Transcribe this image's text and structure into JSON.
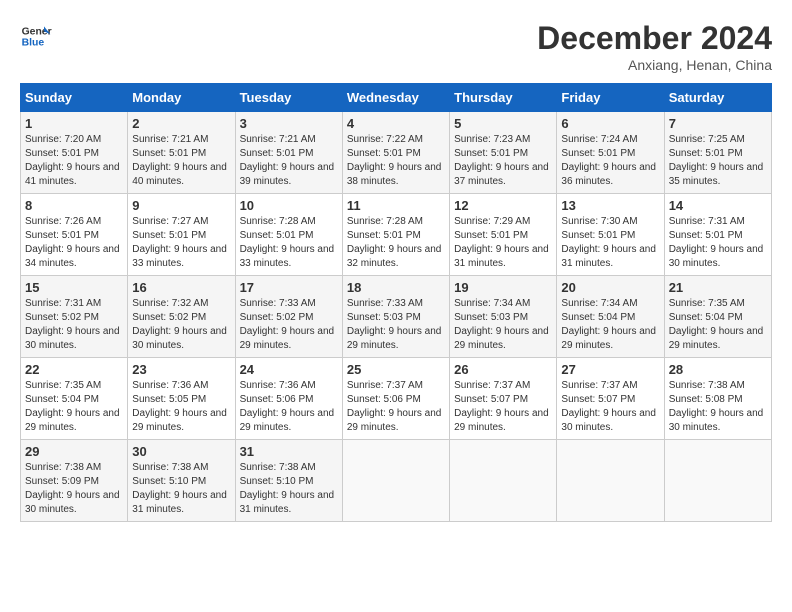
{
  "header": {
    "logo_line1": "General",
    "logo_line2": "Blue",
    "month": "December 2024",
    "location": "Anxiang, Henan, China"
  },
  "weekdays": [
    "Sunday",
    "Monday",
    "Tuesday",
    "Wednesday",
    "Thursday",
    "Friday",
    "Saturday"
  ],
  "weeks": [
    [
      {
        "day": "1",
        "sunrise": "7:20 AM",
        "sunset": "5:01 PM",
        "daylight": "9 hours and 41 minutes."
      },
      {
        "day": "2",
        "sunrise": "7:21 AM",
        "sunset": "5:01 PM",
        "daylight": "9 hours and 40 minutes."
      },
      {
        "day": "3",
        "sunrise": "7:21 AM",
        "sunset": "5:01 PM",
        "daylight": "9 hours and 39 minutes."
      },
      {
        "day": "4",
        "sunrise": "7:22 AM",
        "sunset": "5:01 PM",
        "daylight": "9 hours and 38 minutes."
      },
      {
        "day": "5",
        "sunrise": "7:23 AM",
        "sunset": "5:01 PM",
        "daylight": "9 hours and 37 minutes."
      },
      {
        "day": "6",
        "sunrise": "7:24 AM",
        "sunset": "5:01 PM",
        "daylight": "9 hours and 36 minutes."
      },
      {
        "day": "7",
        "sunrise": "7:25 AM",
        "sunset": "5:01 PM",
        "daylight": "9 hours and 35 minutes."
      }
    ],
    [
      {
        "day": "8",
        "sunrise": "7:26 AM",
        "sunset": "5:01 PM",
        "daylight": "9 hours and 34 minutes."
      },
      {
        "day": "9",
        "sunrise": "7:27 AM",
        "sunset": "5:01 PM",
        "daylight": "9 hours and 33 minutes."
      },
      {
        "day": "10",
        "sunrise": "7:28 AM",
        "sunset": "5:01 PM",
        "daylight": "9 hours and 33 minutes."
      },
      {
        "day": "11",
        "sunrise": "7:28 AM",
        "sunset": "5:01 PM",
        "daylight": "9 hours and 32 minutes."
      },
      {
        "day": "12",
        "sunrise": "7:29 AM",
        "sunset": "5:01 PM",
        "daylight": "9 hours and 31 minutes."
      },
      {
        "day": "13",
        "sunrise": "7:30 AM",
        "sunset": "5:01 PM",
        "daylight": "9 hours and 31 minutes."
      },
      {
        "day": "14",
        "sunrise": "7:31 AM",
        "sunset": "5:01 PM",
        "daylight": "9 hours and 30 minutes."
      }
    ],
    [
      {
        "day": "15",
        "sunrise": "7:31 AM",
        "sunset": "5:02 PM",
        "daylight": "9 hours and 30 minutes."
      },
      {
        "day": "16",
        "sunrise": "7:32 AM",
        "sunset": "5:02 PM",
        "daylight": "9 hours and 30 minutes."
      },
      {
        "day": "17",
        "sunrise": "7:33 AM",
        "sunset": "5:02 PM",
        "daylight": "9 hours and 29 minutes."
      },
      {
        "day": "18",
        "sunrise": "7:33 AM",
        "sunset": "5:03 PM",
        "daylight": "9 hours and 29 minutes."
      },
      {
        "day": "19",
        "sunrise": "7:34 AM",
        "sunset": "5:03 PM",
        "daylight": "9 hours and 29 minutes."
      },
      {
        "day": "20",
        "sunrise": "7:34 AM",
        "sunset": "5:04 PM",
        "daylight": "9 hours and 29 minutes."
      },
      {
        "day": "21",
        "sunrise": "7:35 AM",
        "sunset": "5:04 PM",
        "daylight": "9 hours and 29 minutes."
      }
    ],
    [
      {
        "day": "22",
        "sunrise": "7:35 AM",
        "sunset": "5:04 PM",
        "daylight": "9 hours and 29 minutes."
      },
      {
        "day": "23",
        "sunrise": "7:36 AM",
        "sunset": "5:05 PM",
        "daylight": "9 hours and 29 minutes."
      },
      {
        "day": "24",
        "sunrise": "7:36 AM",
        "sunset": "5:06 PM",
        "daylight": "9 hours and 29 minutes."
      },
      {
        "day": "25",
        "sunrise": "7:37 AM",
        "sunset": "5:06 PM",
        "daylight": "9 hours and 29 minutes."
      },
      {
        "day": "26",
        "sunrise": "7:37 AM",
        "sunset": "5:07 PM",
        "daylight": "9 hours and 29 minutes."
      },
      {
        "day": "27",
        "sunrise": "7:37 AM",
        "sunset": "5:07 PM",
        "daylight": "9 hours and 30 minutes."
      },
      {
        "day": "28",
        "sunrise": "7:38 AM",
        "sunset": "5:08 PM",
        "daylight": "9 hours and 30 minutes."
      }
    ],
    [
      {
        "day": "29",
        "sunrise": "7:38 AM",
        "sunset": "5:09 PM",
        "daylight": "9 hours and 30 minutes."
      },
      {
        "day": "30",
        "sunrise": "7:38 AM",
        "sunset": "5:10 PM",
        "daylight": "9 hours and 31 minutes."
      },
      {
        "day": "31",
        "sunrise": "7:38 AM",
        "sunset": "5:10 PM",
        "daylight": "9 hours and 31 minutes."
      },
      null,
      null,
      null,
      null
    ]
  ]
}
